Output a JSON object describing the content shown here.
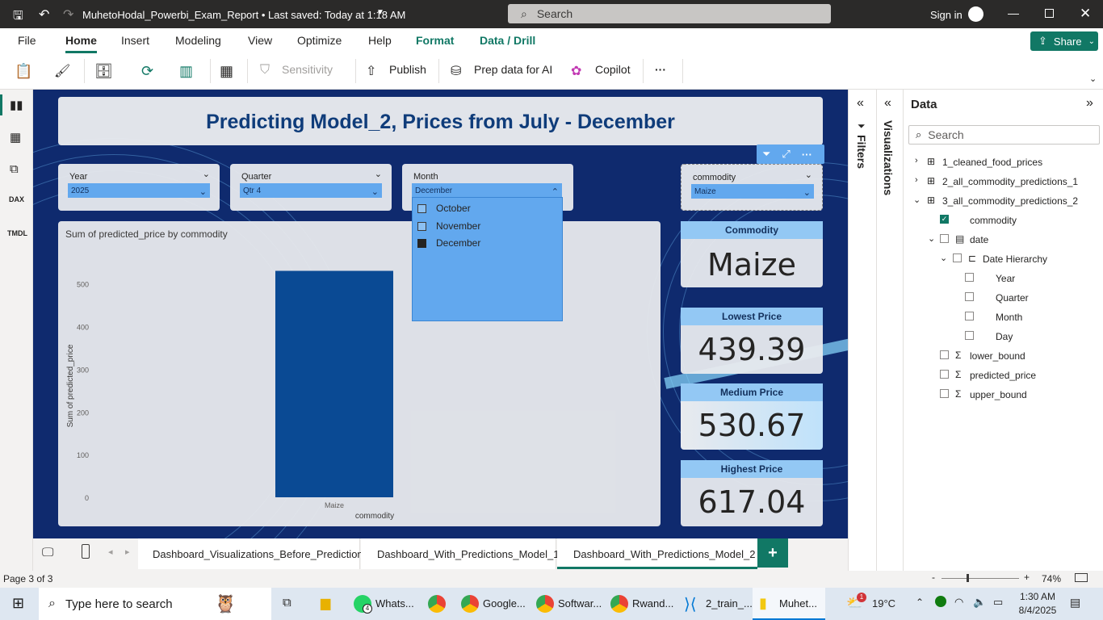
{
  "titlebar": {
    "file_title": "MuhetoHodal_Powerbi_Exam_Report • Last saved: Today at 1:18 AM",
    "search_placeholder": "Search",
    "signin": "Sign in"
  },
  "ribbon": {
    "tabs": [
      "File",
      "Home",
      "Insert",
      "Modeling",
      "View",
      "Optimize",
      "Help",
      "Format",
      "Data / Drill"
    ],
    "share": "Share",
    "toolbar": {
      "sensitivity": "Sensitivity",
      "publish": "Publish",
      "prep": "Prep data for AI",
      "copilot": "Copilot",
      "more": "···"
    }
  },
  "report": {
    "title": "Predicting Model_2, Prices from July - December",
    "slicers": [
      {
        "label": "Year",
        "value": "2025"
      },
      {
        "label": "Quarter",
        "value": "Qtr 4"
      },
      {
        "label": "Month",
        "value": "December"
      },
      {
        "label": "commodity",
        "value": "Maize"
      }
    ],
    "month_options": [
      {
        "label": "October",
        "checked": false
      },
      {
        "label": "November",
        "checked": false
      },
      {
        "label": "December",
        "checked": true
      }
    ],
    "cards": [
      {
        "title": "Commodity",
        "value": "Maize"
      },
      {
        "title": "Lowest Price",
        "value": "439.39"
      },
      {
        "title": "Medium Price",
        "value": "530.67"
      },
      {
        "title": "Highest Price",
        "value": "617.04"
      }
    ]
  },
  "chart_data": {
    "type": "bar",
    "title": "Sum of predicted_price by commodity",
    "xlabel": "commodity",
    "ylabel": "Sum of predicted_price",
    "categories": [
      "Maize"
    ],
    "values": [
      530.67
    ],
    "ylim": [
      0,
      560
    ],
    "yticks": [
      0,
      100,
      200,
      300,
      400,
      500
    ],
    "bar_color": "#0a4a94"
  },
  "panes": {
    "filters": "Filters",
    "visualizations": "Visualizations",
    "data": {
      "title": "Data",
      "search_placeholder": "Search",
      "tables": [
        "1_cleaned_food_prices",
        "2_all_commodity_predictions_1",
        "3_all_commodity_predictions_2"
      ],
      "fields": [
        "commodity",
        "date",
        "Date Hierarchy",
        "Year",
        "Quarter",
        "Month",
        "Day",
        "lower_bound",
        "predicted_price",
        "upper_bound"
      ]
    }
  },
  "pages": [
    "Dashboard_Visualizations_Before_Predictions",
    "Dashboard_With_Predictions_Model_1",
    "Dashboard_With_Predictions_Model_2"
  ],
  "status": {
    "page": "Page 3 of 3",
    "zoom": "74%"
  },
  "taskbar": {
    "search": "Type here to search",
    "apps": [
      "Whats...",
      "Google...",
      "Softwar...",
      "Rwand...",
      "2_train_...",
      "Muhet..."
    ],
    "whatsapp_badge": "4",
    "weather": "19°C",
    "weather_badge": "1",
    "time": "1:30 AM",
    "date": "8/4/2025"
  }
}
